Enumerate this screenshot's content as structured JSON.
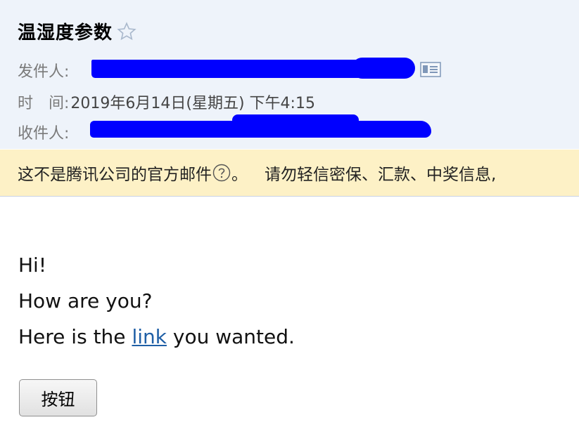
{
  "email": {
    "subject": "温湿度参数",
    "sender_label": "发件人:",
    "time_label": "时　间:",
    "time_value": "2019年6月14日(星期五) 下午4:15",
    "recipient_label": "收件人:"
  },
  "warning": {
    "text_prefix": "这不是腾讯公司的官方邮件",
    "text_period": "。",
    "text_tail": "请勿轻信密保、汇款、中奖信息,"
  },
  "body": {
    "line1": "Hi!",
    "line2": "How are you?",
    "line3_before": "Here is the ",
    "link_text": "link",
    "line3_after": " you wanted."
  },
  "button": {
    "label": "按钮"
  },
  "icons": {
    "star": "star-outline-icon",
    "card": "contact-card-icon",
    "help": "help-circle-icon"
  },
  "colors": {
    "header_bg": "#eef3fa",
    "warning_bg": "#fdf1c6",
    "redaction": "#0000ff",
    "link": "#1f5fa6"
  }
}
